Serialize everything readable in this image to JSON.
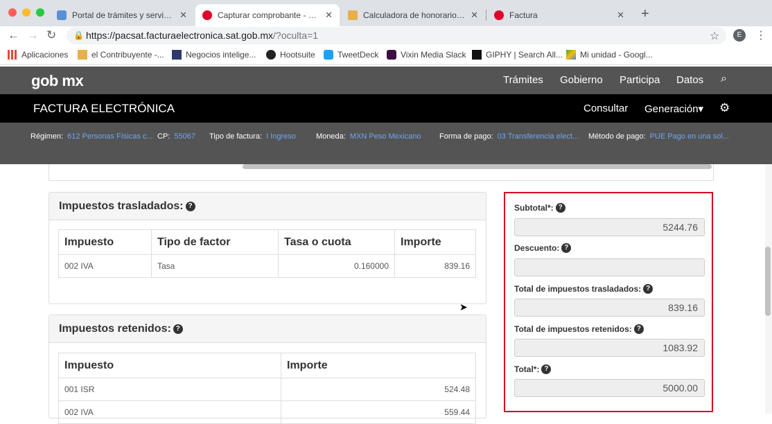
{
  "browser": {
    "tabs": [
      {
        "title": "Portal de trámites y servicios - ",
        "active": false
      },
      {
        "title": "Capturar comprobante - Factur",
        "active": true
      },
      {
        "title": "Calculadora de honorarios | el",
        "active": false
      },
      {
        "title": "Factura",
        "active": false
      }
    ],
    "url_main": "https://pacsat.facturaelectronica.sat.gob.mx",
    "url_rest": "/?oculta=1",
    "profile_initial": "E",
    "bookmarks": [
      "Aplicaciones",
      "el Contribuyente -...",
      "Negocios intelige...",
      "Hootsuite",
      "TweetDeck",
      "Vixin Media Slack",
      "GIPHY | Search All...",
      "Mi unidad - Googl..."
    ]
  },
  "gob_header": {
    "logo": "gob mx",
    "nav": [
      "Trámites",
      "Gobierno",
      "Participa",
      "Datos"
    ]
  },
  "factura_header": {
    "title": "FACTURA ELECTRÓNICA",
    "consultar": "Consultar",
    "generacion": "Generación▾"
  },
  "info_bar": {
    "regimen_label": "Régimen:",
    "regimen_value": "612 Personas Físicas c...",
    "cp_label": "CP:",
    "cp_value": "55067",
    "tipo_label": "Tipo de factura:",
    "tipo_value": "I Ingreso",
    "moneda_label": "Moneda:",
    "moneda_value": "MXN Peso Mexicano",
    "forma_label": "Forma de pago:",
    "forma_value": "03 Transferencia elect...",
    "metodo_label": "Método de pago:",
    "metodo_value": "PUE Pago en una sol..."
  },
  "trasladados": {
    "title": "Impuestos trasladados:",
    "headers": [
      "Impuesto",
      "Tipo de factor",
      "Tasa o cuota",
      "Importe"
    ],
    "row": [
      "002 IVA",
      "Tasa",
      "0.160000",
      "839.16"
    ]
  },
  "retenidos": {
    "title": "Impuestos retenidos:",
    "headers": [
      "Impuesto",
      "Importe"
    ],
    "rows": [
      [
        "001 ISR",
        "524.48"
      ],
      [
        "002 IVA",
        "559.44"
      ]
    ]
  },
  "totals": {
    "subtotal_label": "Subtotal*:",
    "subtotal_value": "5244.76",
    "descuento_label": "Descuento:",
    "descuento_value": "",
    "trasladados_label": "Total de impuestos trasladados:",
    "trasladados_value": "839.16",
    "retenidos_label": "Total de impuestos retenidos:",
    "retenidos_value": "1083.92",
    "total_label": "Total*:",
    "total_value": "5000.00"
  },
  "colors": {
    "highlight_border": "#d9001b",
    "link_blue": "#6da6f0",
    "gob_gray": "#545454"
  }
}
